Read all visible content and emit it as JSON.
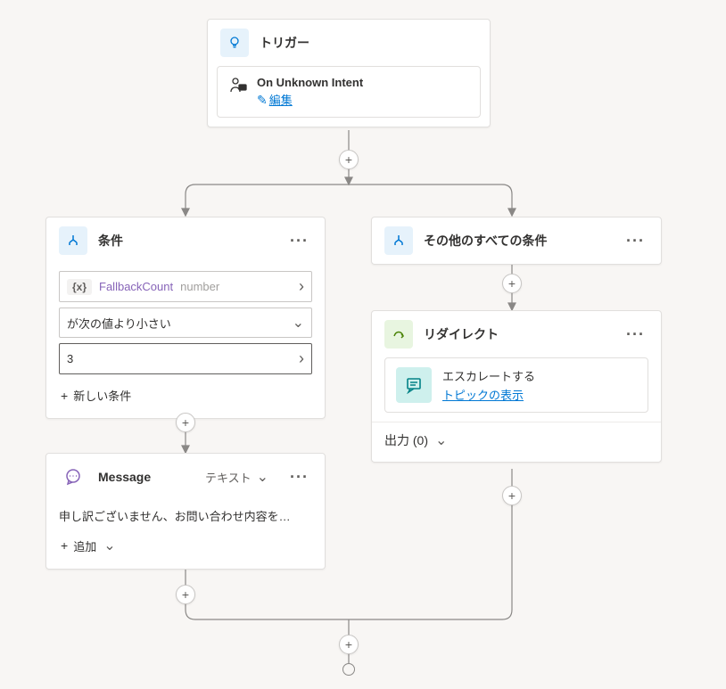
{
  "trigger": {
    "title": "トリガー",
    "intent_name": "On Unknown Intent",
    "edit_label": "編集"
  },
  "condition_left": {
    "title": "条件",
    "variable_badge": "{x}",
    "variable_name": "FallbackCount",
    "variable_type": "number",
    "operator": "が次の値より小さい",
    "value": "3",
    "add_condition": "新しい条件"
  },
  "condition_right": {
    "title": "その他のすべての条件"
  },
  "message": {
    "title": "Message",
    "type_label": "テキスト",
    "text": "申し訳ございません、お問い合わせ内容を…",
    "add_label": "追加"
  },
  "redirect": {
    "title": "リダイレクト",
    "escalate_label": "エスカレートする",
    "view_topic": "トピックの表示",
    "output_label": "出力 (0)"
  }
}
